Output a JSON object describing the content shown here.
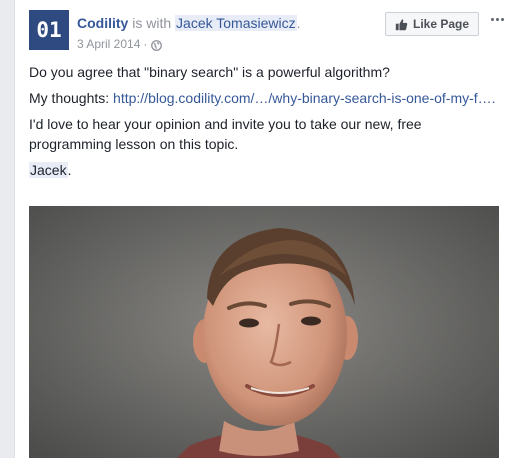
{
  "post": {
    "avatar_text": "01",
    "page_name": "Codility",
    "with_text": " is with ",
    "tagged_name": "Jacek Tomasiewicz",
    "tagged_suffix": ".",
    "date": "3 April 2014",
    "date_separator": "·",
    "privacy_icon": "globe-icon",
    "like_page_label": "Like Page",
    "like_icon": "thumbs-up-icon",
    "more_icon": "more-options-icon",
    "text": {
      "line1": "Do you agree that \"binary search\" is a powerful algorithm?",
      "thoughts_prefix": "My thoughts: ",
      "thoughts_link": "http://blog.codility.com/…/why-binary-search-is-one-of-my-f….",
      "line3": "I'd love to hear your opinion and invite you to take our new, free programming lesson on this topic.",
      "signature": "Jacek",
      "signature_suffix": "."
    },
    "colors": {
      "brand_blue": "#365899",
      "avatar_bg": "#2e4a80",
      "meta_gray": "#90949c",
      "tag_highlight": "#e7ecf6"
    }
  }
}
